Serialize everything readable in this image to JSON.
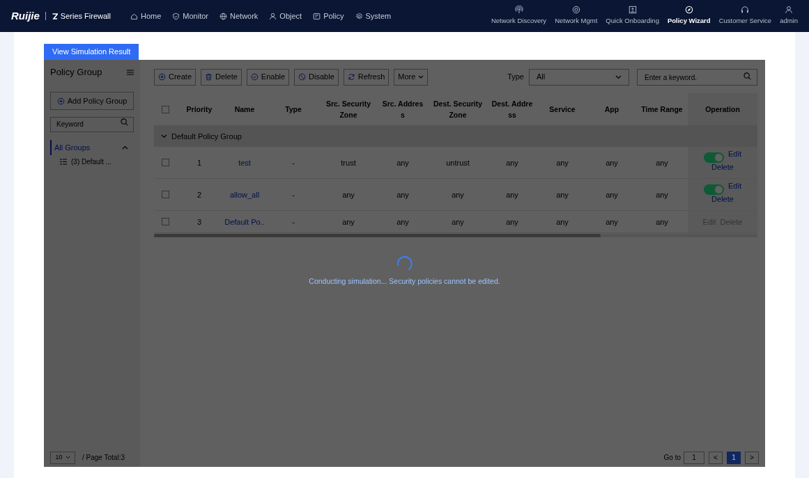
{
  "brand": {
    "logo": "Ruijie",
    "product": "Series Firewall"
  },
  "nav": [
    {
      "label": "Home"
    },
    {
      "label": "Monitor"
    },
    {
      "label": "Network"
    },
    {
      "label": "Object"
    },
    {
      "label": "Policy"
    },
    {
      "label": "System"
    }
  ],
  "tools": [
    {
      "label": "Network Discovery",
      "selected": false
    },
    {
      "label": "Network Mgmt",
      "selected": false
    },
    {
      "label": "Quick Onboarding",
      "selected": false
    },
    {
      "label": "Policy Wizard",
      "selected": true
    },
    {
      "label": "Customer Service",
      "selected": false
    },
    {
      "label": "admin",
      "selected": false
    }
  ],
  "simulation_button": "View Simulation Result",
  "sidebar": {
    "title": "Policy Group",
    "add_button": "Add Policy Group",
    "search_placeholder": "Keyword",
    "all_groups": "All Groups",
    "groups": [
      "(3) Default ..."
    ]
  },
  "toolbar": {
    "buttons": [
      {
        "label": "Create"
      },
      {
        "label": "Delete"
      },
      {
        "label": "Enable"
      },
      {
        "label": "Disable"
      },
      {
        "label": "Refresh"
      }
    ],
    "more": "More",
    "type_label": "Type",
    "type_value": "All",
    "search_placeholder": "Enter a keyword."
  },
  "table": {
    "select_all_checked": false,
    "columns": [
      "Priority",
      "Name",
      "Type",
      "Src. Security Zone",
      "Src. Address",
      "Dest. Security Zone",
      "Dest. Address",
      "Service",
      "App",
      "Time Range",
      "Operation"
    ],
    "group": "Default Policy Group",
    "rows": [
      {
        "checked": false,
        "cells": [
          "1",
          "test",
          "-",
          "trust",
          "any",
          "untrust",
          "any",
          "any",
          "any",
          "any"
        ],
        "editable": true,
        "enabled": true,
        "edit": "Edit",
        "delete": "Delete"
      },
      {
        "checked": false,
        "cells": [
          "2",
          "allow_all",
          "-",
          "any",
          "any",
          "any",
          "any",
          "any",
          "any",
          "any"
        ],
        "editable": true,
        "enabled": true,
        "edit": "Edit",
        "delete": "Delete"
      },
      {
        "checked": false,
        "cells": [
          "3",
          "Default Po..",
          "-",
          "any",
          "any",
          "any",
          "any",
          "any",
          "any",
          "any"
        ],
        "editable": false,
        "edit": "Edit",
        "delete": "Delete"
      }
    ]
  },
  "status": "Conducting simulation... Security policies cannot be edited.",
  "pagination": {
    "page_size": "10",
    "total": "/ Page Total:3",
    "goto": "Go to",
    "goto_value": "1",
    "prev": "<",
    "pages": [
      {
        "label": "1",
        "selected": true
      }
    ],
    "next": ">"
  }
}
